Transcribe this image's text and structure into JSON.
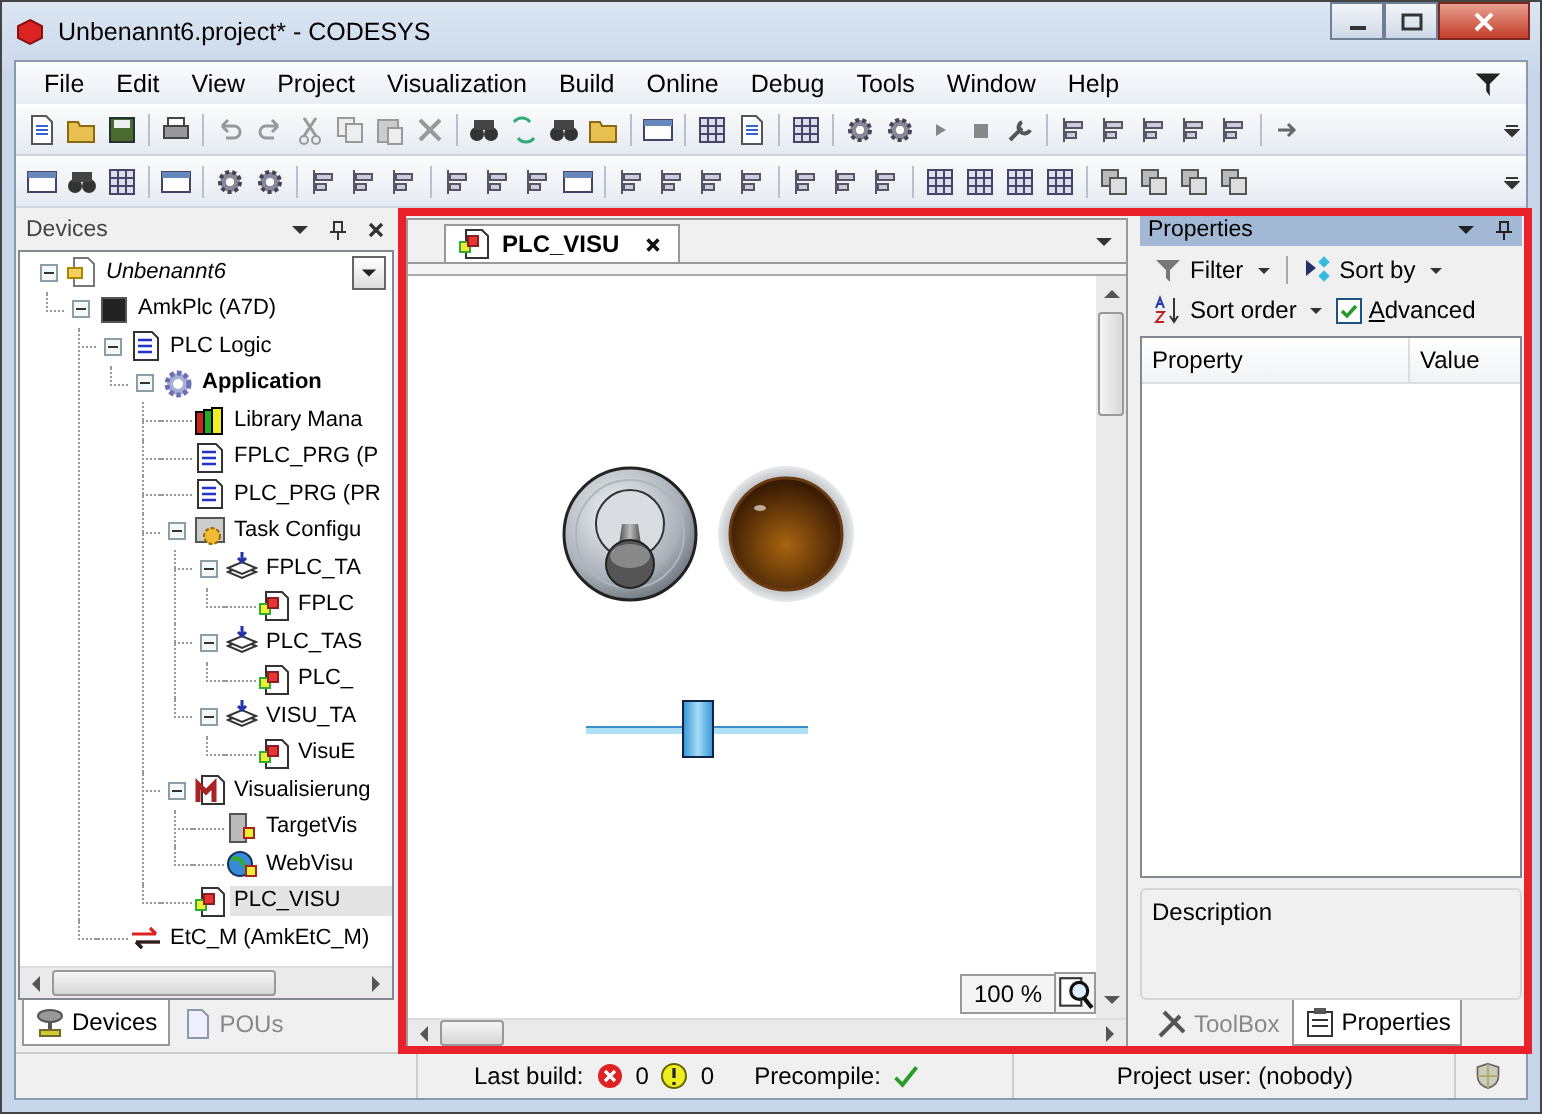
{
  "window": {
    "title": "Unbenannt6.project* - CODESYS"
  },
  "menu": [
    "File",
    "Edit",
    "View",
    "Project",
    "Visualization",
    "Build",
    "Online",
    "Debug",
    "Tools",
    "Window",
    "Help"
  ],
  "devices_panel": {
    "title": "Devices",
    "tree": [
      {
        "label": "Unbenannt6",
        "kind": "project",
        "selected": false,
        "expanded": true,
        "children": [
          {
            "label": "AmkPlc (A7D)",
            "kind": "device",
            "selected": false,
            "expanded": true,
            "children": [
              {
                "label": "PLC Logic",
                "kind": "plc_logic",
                "selected": false,
                "expanded": true,
                "children": [
                  {
                    "label": "Application",
                    "kind": "application",
                    "selected": false,
                    "expanded": true,
                    "children": [
                      {
                        "label": "Library Mana",
                        "kind": "library",
                        "selected": false
                      },
                      {
                        "label": "FPLC_PRG (P",
                        "kind": "program",
                        "selected": false
                      },
                      {
                        "label": "PLC_PRG (PR",
                        "kind": "program",
                        "selected": false
                      },
                      {
                        "label": "Task Configu",
                        "kind": "task_configuration",
                        "selected": false,
                        "expanded": true,
                        "children": [
                          {
                            "label": "FPLC_TA",
                            "kind": "task",
                            "selected": false,
                            "expanded": true,
                            "children": [
                              {
                                "label": "FPLC",
                                "kind": "task_call",
                                "selected": false
                              }
                            ]
                          },
                          {
                            "label": "PLC_TAS",
                            "kind": "task",
                            "selected": false,
                            "expanded": true,
                            "children": [
                              {
                                "label": "PLC_",
                                "kind": "task_call",
                                "selected": false
                              }
                            ]
                          },
                          {
                            "label": "VISU_TA",
                            "kind": "task",
                            "selected": false,
                            "expanded": true,
                            "children": [
                              {
                                "label": "VisuE",
                                "kind": "task_call",
                                "selected": false
                              }
                            ]
                          }
                        ]
                      },
                      {
                        "label": "Visualisierung",
                        "kind": "visu_manager",
                        "selected": false,
                        "expanded": true,
                        "children": [
                          {
                            "label": "TargetVis",
                            "kind": "target_visu",
                            "selected": false
                          },
                          {
                            "label": "WebVisu",
                            "kind": "web_visu",
                            "selected": false
                          }
                        ]
                      },
                      {
                        "label": "PLC_VISU",
                        "kind": "visualization",
                        "selected": true
                      }
                    ]
                  }
                ]
              },
              {
                "label": "EtC_M (AmkEtC_M)",
                "kind": "ethercat",
                "selected": false
              }
            ]
          }
        ]
      }
    ],
    "tabs": [
      {
        "label": "Devices",
        "selected": true
      },
      {
        "label": "POUs",
        "selected": false
      }
    ]
  },
  "editor": {
    "tabs": [
      {
        "label": "PLC_VISU",
        "selected": true
      }
    ],
    "slider": {
      "level": 0.5
    },
    "zoom": "100 %"
  },
  "properties_panel": {
    "title": "Properties",
    "toolbar": [
      {
        "kind": "dropdown",
        "label": "Filter"
      },
      {
        "kind": "dropdown",
        "label": "Sort by"
      },
      {
        "kind": "dropdown",
        "label": "Sort order"
      },
      {
        "kind": "checkbox",
        "label": "Advanced",
        "checked": true
      }
    ],
    "columns": [
      "Property",
      "Value"
    ],
    "description": "Description",
    "tabs": [
      {
        "label": "ToolBox",
        "selected": false
      },
      {
        "label": "Properties",
        "selected": true
      }
    ]
  },
  "status_bar": {
    "last_build_label": "Last build:",
    "errors": "0",
    "warnings": "0",
    "precompile_label": "Precompile:",
    "precompile_ok": true,
    "project_user": "Project user: (nobody)"
  }
}
